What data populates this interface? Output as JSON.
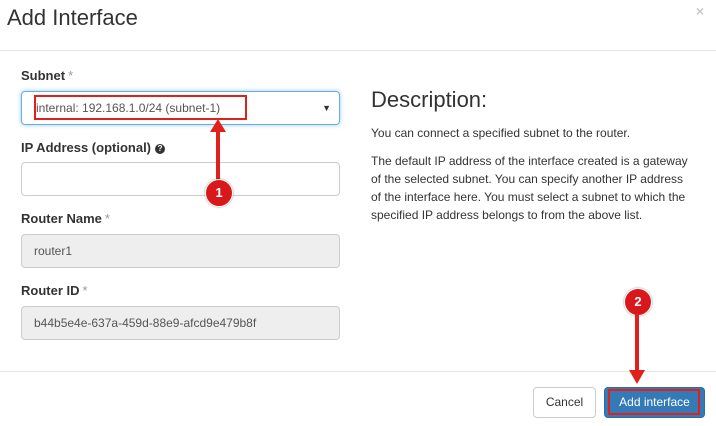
{
  "dialog": {
    "title": "Add Interface",
    "close_symbol": "×"
  },
  "form": {
    "required_marker": "*",
    "subnet": {
      "label": "Subnet",
      "selected": "internal: 192.168.1.0/24 (subnet-1)",
      "caret": "▼"
    },
    "ip_address": {
      "label": "IP Address (optional)",
      "help_icon": "?",
      "value": ""
    },
    "router_name": {
      "label": "Router Name",
      "value": "router1"
    },
    "router_id": {
      "label": "Router ID",
      "value": "b44b5e4e-637a-459d-88e9-afcd9e479b8f"
    }
  },
  "description": {
    "title": "Description:",
    "paragraph_1": "You can connect a specified subnet to the router.",
    "paragraph_2": "The default IP address of the interface created is a gateway of the selected subnet. You can specify another IP address of the interface here. You must select a subnet to which the specified IP address belongs to from the above list."
  },
  "footer": {
    "cancel_label": "Cancel",
    "submit_label": "Add interface"
  },
  "annotations": {
    "badge_1": "1",
    "badge_2": "2"
  },
  "colors": {
    "annotation_red": "#e0201b",
    "primary": "#337ab7"
  }
}
